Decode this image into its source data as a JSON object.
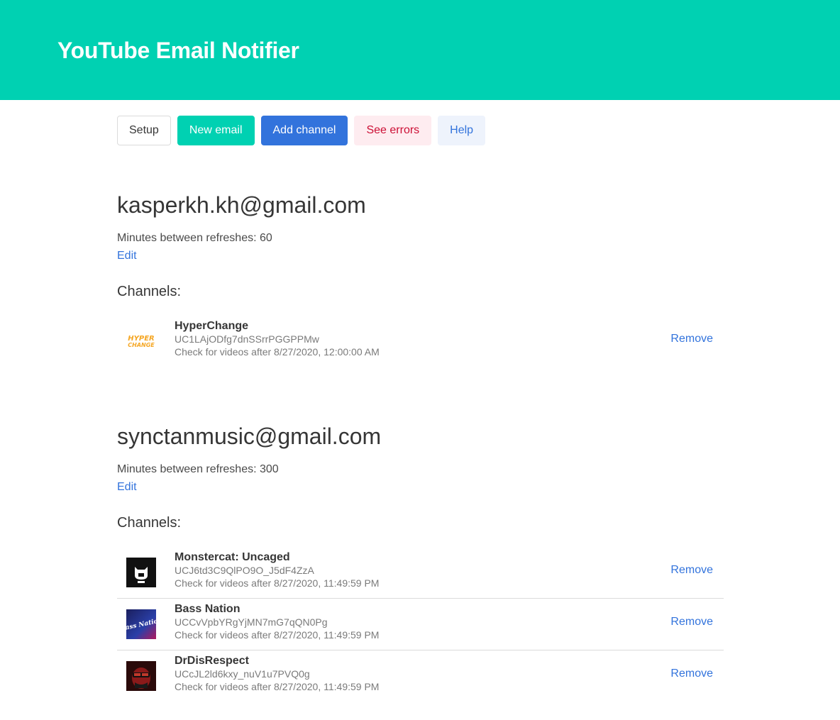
{
  "app": {
    "title": "YouTube Email Notifier"
  },
  "toolbar": {
    "setup": "Setup",
    "new_email": "New email",
    "add_channel": "Add channel",
    "see_errors": "See errors",
    "help": "Help"
  },
  "colors": {
    "primary": "#00d1b2",
    "link": "#3273dc",
    "danger_light_bg": "#feecf0",
    "danger_text": "#cc0f35",
    "info_light_bg": "#eef3fc"
  },
  "emails": [
    {
      "address": "kasperkh.kh@gmail.com",
      "refresh_label": "Minutes between refreshes: 60",
      "edit_label": "Edit",
      "channels_label": "Channels:",
      "channels": [
        {
          "name": "HyperChange",
          "id": "UC1LAjODfg7dnSSrrPGGPPMw",
          "check": "Check for videos after 8/27/2020, 12:00:00 AM",
          "logo_text_1": "HYPER",
          "logo_text_2": "CHANGE",
          "remove_label": "Remove"
        }
      ]
    },
    {
      "address": "synctanmusic@gmail.com",
      "refresh_label": "Minutes between refreshes: 300",
      "edit_label": "Edit",
      "channels_label": "Channels:",
      "channels": [
        {
          "name": "Monstercat: Uncaged",
          "id": "UCJ6td3C9QlPO9O_J5dF4ZzA",
          "check": "Check for videos after 8/27/2020, 11:49:59 PM",
          "remove_label": "Remove"
        },
        {
          "name": "Bass Nation",
          "id": "UCCvVpbYRgYjMN7mG7qQN0Pg",
          "check": "Check for videos after 8/27/2020, 11:49:59 PM",
          "logo_text": "Bass Nation",
          "remove_label": "Remove"
        },
        {
          "name": "DrDisRespect",
          "id": "UCcJL2ld6kxy_nuV1u7PVQ0g",
          "check": "Check for videos after 8/27/2020, 11:49:59 PM",
          "remove_label": "Remove"
        }
      ]
    }
  ]
}
